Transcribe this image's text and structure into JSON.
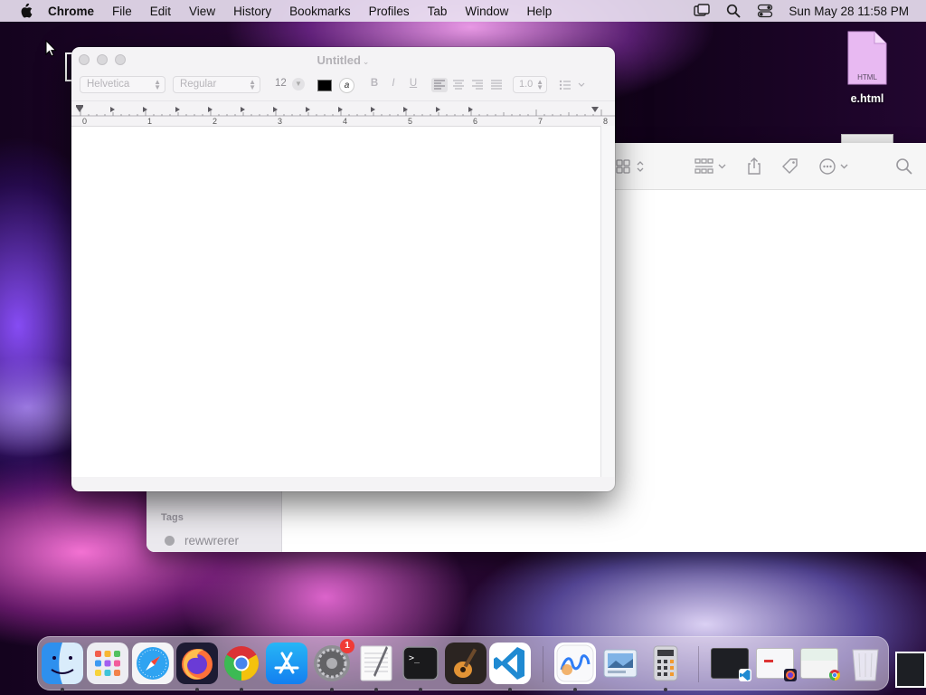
{
  "menubar": {
    "apple_icon": "apple-logo-icon",
    "items": [
      "Chrome",
      "File",
      "Edit",
      "View",
      "History",
      "Bookmarks",
      "Profiles",
      "Tab",
      "Window",
      "Help"
    ],
    "status_icons": [
      "screen-mirroring-icon",
      "spotlight-search-icon",
      "control-center-icon"
    ],
    "clock": "Sun May 28  11:58 PM"
  },
  "desktop": {
    "file_type_label": "HTML",
    "file_name": "e.html"
  },
  "finder": {
    "toolbar_icons": [
      "view-grid-icon",
      "group-by-icon",
      "share-icon",
      "tag-icon",
      "action-ellipsis-icon",
      "search-icon"
    ],
    "tags_header": "Tags",
    "tags": [
      "rewwrerer"
    ]
  },
  "textedit": {
    "title": "Untitled",
    "font_family": "Helvetica",
    "font_style": "Regular",
    "font_size": "12",
    "text_color": "#000000",
    "bold_label": "B",
    "italic_label": "I",
    "underline_label": "U",
    "alignment": "left",
    "line_spacing": "1.0",
    "ruler_numbers": [
      "0",
      "1",
      "2",
      "3",
      "4",
      "5",
      "6",
      "7",
      "8"
    ]
  },
  "dock": {
    "apps": [
      {
        "name": "Finder",
        "icon": "finder-icon",
        "running": true
      },
      {
        "name": "Launchpad",
        "icon": "launchpad-icon",
        "running": false
      },
      {
        "name": "Safari",
        "icon": "safari-icon",
        "running": false
      },
      {
        "name": "Firefox",
        "icon": "firefox-icon",
        "running": true
      },
      {
        "name": "Google Chrome",
        "icon": "chrome-icon",
        "running": true
      },
      {
        "name": "App Store",
        "icon": "app-store-icon",
        "running": false
      },
      {
        "name": "System Preferences",
        "icon": "system-preferences-icon",
        "running": true,
        "badge": "1"
      },
      {
        "name": "TextEdit",
        "icon": "textedit-icon",
        "running": true
      },
      {
        "name": "Terminal",
        "icon": "terminal-icon",
        "running": true
      },
      {
        "name": "GarageBand",
        "icon": "garageband-icon",
        "running": false
      },
      {
        "name": "Visual Studio Code",
        "icon": "vscode-icon",
        "running": true
      },
      {
        "name": "Freeform",
        "icon": "freeform-icon",
        "running": true
      },
      {
        "name": "Preview",
        "icon": "preview-icon",
        "running": false
      },
      {
        "name": "Calculator",
        "icon": "calculator-icon",
        "running": true
      }
    ],
    "recent": [
      "vscode-window-thumbnail",
      "browser-window-thumbnail",
      "chrome-window-thumbnail"
    ],
    "trash_icon": "trash-icon"
  },
  "colors": {
    "accent_badge": "#f03b36",
    "vscode_blue": "#1f8ad2"
  }
}
